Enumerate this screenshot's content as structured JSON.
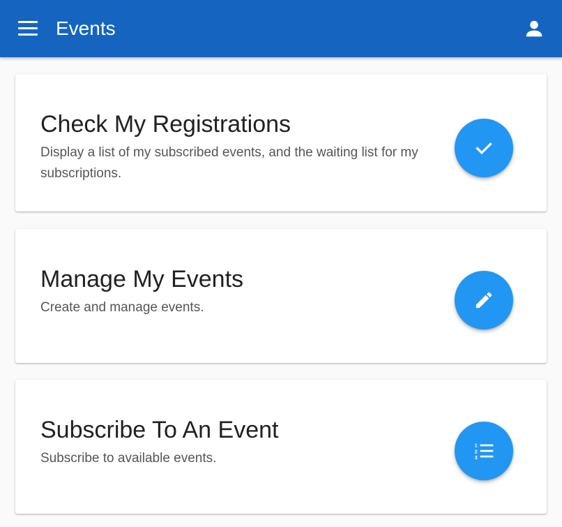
{
  "appbar": {
    "title": "Events",
    "menu_icon": "menu-icon",
    "account_icon": "account-icon",
    "color": "#1565c0"
  },
  "cards": [
    {
      "title": "Check My Registrations",
      "description": "Display a list of my subscribed events, and the waiting list for my subscriptions.",
      "icon": "check-icon"
    },
    {
      "title": "Manage My Events",
      "description": "Create and manage events.",
      "icon": "pencil-icon"
    },
    {
      "title": "Subscribe To An Event",
      "description": "Subscribe to available events.",
      "icon": "numbered-list-icon"
    }
  ],
  "accent_color": "#2196f3"
}
